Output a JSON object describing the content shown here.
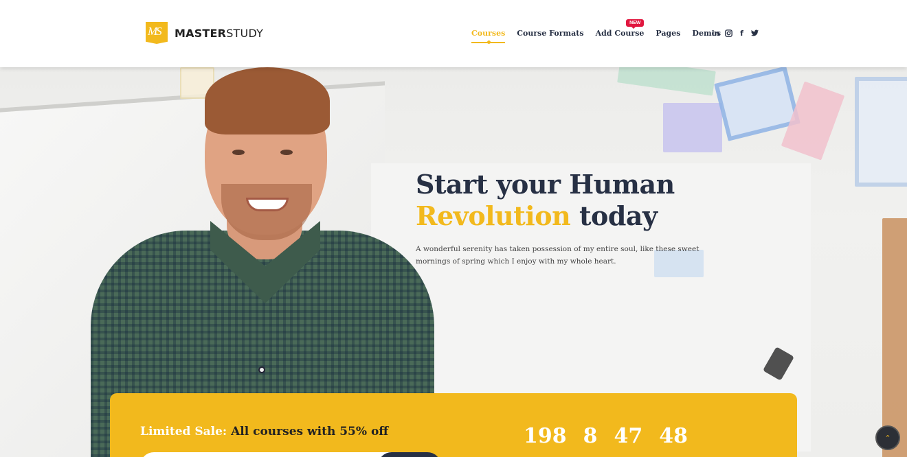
{
  "brand": {
    "logo_mark": "MS",
    "name_bold": "MASTER",
    "name_light": "STUDY"
  },
  "nav": {
    "items": [
      {
        "label": "Courses",
        "active": true
      },
      {
        "label": "Course Formats"
      },
      {
        "label": "Add Course",
        "badge": "NEW"
      },
      {
        "label": "Pages"
      },
      {
        "label": "Demos"
      }
    ]
  },
  "social": {
    "linkedin": "in",
    "instagram": "◎",
    "facebook": "f",
    "twitter": "🐦"
  },
  "hero": {
    "title_line1": "Start your Human",
    "title_accent": "Revolution",
    "title_rest": " today",
    "description": "A wonderful serenity has taken possession of my entire soul, like these sweet mornings of spring which I enjoy with my whole heart."
  },
  "sale": {
    "prefix": "Limited Sale: ",
    "main": "All courses with 55% off",
    "countdown": [
      "198",
      "8",
      "47",
      "48"
    ]
  },
  "back_to_top": "⌃",
  "colors": {
    "accent": "#f2b91d",
    "dark": "#273044",
    "badge": "#e1173f"
  }
}
